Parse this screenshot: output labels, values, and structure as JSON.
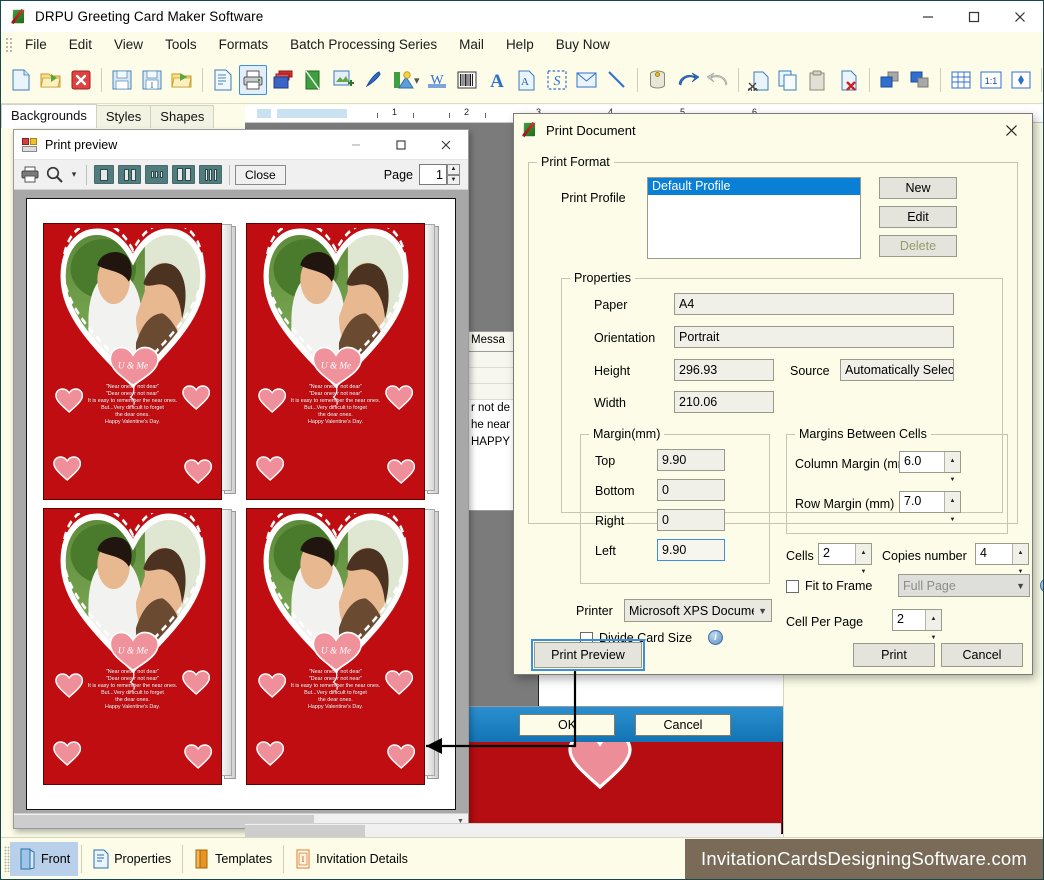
{
  "window": {
    "title": "DRPU Greeting Card Maker Software",
    "minimize": "—",
    "maximize": "☐",
    "close": "✕"
  },
  "menu": {
    "items": [
      "File",
      "Edit",
      "View",
      "Tools",
      "Formats",
      "Batch Processing Series",
      "Mail",
      "Help",
      "Buy Now"
    ]
  },
  "toolbar": {
    "overflow": "»",
    "icons": [
      "new-document-icon",
      "open-folder-icon",
      "delete-document-icon",
      "sep",
      "save-icon",
      "save-as-icon",
      "export-icon",
      "sep",
      "page-setup-icon",
      "print-icon",
      "card-layers-icon",
      "design-icon",
      "insert-image-icon",
      "pen-icon",
      "shape-icon",
      "chevron-down-icon",
      "watermark-icon",
      "barcode-icon",
      "text-icon",
      "text-style-icon",
      "signature-icon",
      "envelope-icon",
      "line-icon",
      "sep",
      "database-icon",
      "undo-icon",
      "redo-icon",
      "sep",
      "cut-icon",
      "copy-icon",
      "paste-icon",
      "delete-item-icon",
      "sep",
      "bring-front-icon",
      "send-back-icon",
      "sep",
      "grid-icon",
      "actual-size-icon",
      "fit-page-icon",
      "sep",
      "zoom-icon"
    ]
  },
  "tabs": {
    "items": [
      {
        "label": "Backgrounds",
        "active": true
      },
      {
        "label": "Styles",
        "active": false
      },
      {
        "label": "Shapes",
        "active": false
      }
    ]
  },
  "ruler": {
    "numbers": [
      "1",
      "2",
      "3",
      "4",
      "5",
      "6"
    ]
  },
  "message_table": {
    "header": "Messa",
    "lines": [
      "r not de",
      "he near",
      "HAPPY"
    ]
  },
  "behind_dialog": {
    "ok_label": "OK",
    "cancel_label": "Cancel"
  },
  "print_preview": {
    "title": "Print preview",
    "minimize": "—",
    "maximize": "☐",
    "close": "✕",
    "toolbar": {
      "print_icon": "printer-icon",
      "zoom_icon": "magnifier-icon",
      "zoom_dropdown": "▾",
      "view_one_page": "one-page-icon",
      "view_two_pages": "two-pages-icon",
      "view_three_pages": "three-pages-icon",
      "view_four_pages": "four-pages-icon",
      "view_six_pages": "six-pages-icon",
      "close_label": "Close",
      "page_label": "Page",
      "page_value": "1"
    },
    "card": {
      "balloon_text": "U & Me",
      "lines": [
        "\"Near ones r not dear\"",
        "\"Dear ones r not near\"",
        "It is easy to remember the near ones.",
        "But...Very difficult to forget",
        "the dear ones.",
        "Happy Valentine's Day."
      ]
    },
    "card_count": 4
  },
  "print_document": {
    "title": "Print Document",
    "close": "✕",
    "print_format_group": "Print Format",
    "print_profile_label": "Print Profile",
    "profiles": [
      "Default Profile"
    ],
    "selected_profile": "Default Profile",
    "buttons": {
      "new": "New",
      "edit": "Edit",
      "delete": "Delete"
    },
    "properties_group": "Properties",
    "properties": {
      "paper_label": "Paper",
      "paper_value": "A4",
      "orientation_label": "Orientation",
      "orientation_value": "Portrait",
      "height_label": "Height",
      "height_value": "296.93",
      "width_label": "Width",
      "width_value": "210.06",
      "source_label": "Source",
      "source_value": "Automatically Selec"
    },
    "margin_group": "Margin(mm)",
    "margins": {
      "top_label": "Top",
      "top_value": "9.90",
      "bottom_label": "Bottom",
      "bottom_value": "0",
      "right_label": "Right",
      "right_value": "0",
      "left_label": "Left",
      "left_value": "9.90"
    },
    "printer_label": "Printer",
    "printer_value": "Microsoft XPS Document",
    "divide_card_size_label": "Divide Card Size",
    "cell_margins_group": "Margins Between Cells",
    "cell_margins": {
      "column_label": "Column Margin (mm)",
      "column_value": "6.0",
      "row_label": "Row Margin (mm)",
      "row_value": "7.0"
    },
    "cells_label": "Cells",
    "cells_value": "2",
    "copies_label": "Copies number",
    "copies_value": "4",
    "fit_to_frame_label": "Fit to Frame",
    "fit_to_frame_value": "Full Page",
    "cell_per_page_label": "Cell Per Page",
    "cell_per_page_value": "2",
    "footer": {
      "print_preview": "Print Preview",
      "print": "Print",
      "cancel": "Cancel"
    }
  },
  "statusbar": {
    "items": [
      {
        "label": "Front",
        "icon": "front-card-icon",
        "active": true
      },
      {
        "label": "Properties",
        "icon": "properties-icon",
        "active": false
      },
      {
        "label": "Templates",
        "icon": "templates-icon",
        "active": false
      },
      {
        "label": "Invitation Details",
        "icon": "invitation-details-icon",
        "active": false
      }
    ],
    "brand": "InvitationCardsDesigningSoftware.com"
  },
  "colors": {
    "app_bg": "#fcfce8",
    "accent_blue": "#0a7fd6",
    "card_red": "#c00d11",
    "brand_bg": "#7a6a58",
    "focus": "#3c8fe0"
  }
}
